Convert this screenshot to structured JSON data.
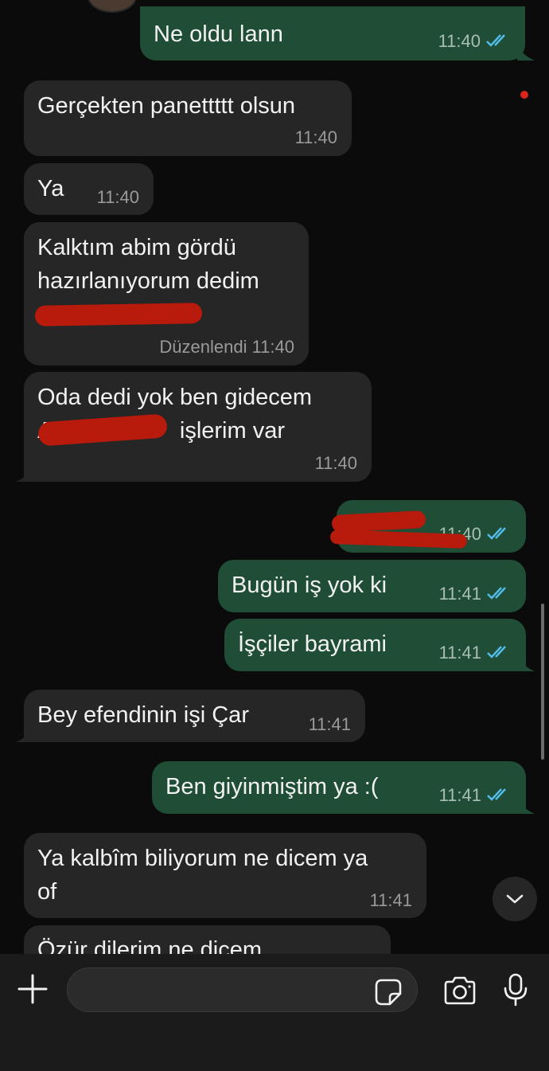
{
  "messages": [
    {
      "direction": "out",
      "text": "Ne oldu lann",
      "time": "11:40"
    },
    {
      "direction": "in",
      "text": "Gerçekten panettttt olsun",
      "time": "11:40"
    },
    {
      "direction": "in",
      "text": "Ya",
      "time": "11:40"
    },
    {
      "direction": "in",
      "text": "Kalktım abim gördü\nhazırlanıyorum dedim",
      "time": "11:40",
      "edited_label": "Düzenlendi"
    },
    {
      "direction": "in",
      "text": "Oda dedi yok ben gidecem\nA                    işlerim var",
      "time": "11:40"
    },
    {
      "direction": "out",
      "text": "",
      "time": "11:40"
    },
    {
      "direction": "out",
      "text": "Bugün iş yok ki",
      "time": "11:41"
    },
    {
      "direction": "out",
      "text": "İşçiler bayrami",
      "time": "11:41"
    },
    {
      "direction": "in",
      "text": "Bey efendinin işi Çar",
      "time": "11:41"
    },
    {
      "direction": "out",
      "text": "Ben giyinmiştim ya :(",
      "time": "11:41"
    },
    {
      "direction": "in",
      "text": "Ya kalbîm biliyorum ne dicem ya\nof",
      "time": "11:41"
    },
    {
      "direction": "in",
      "text": "Özür dilerim ne dicem",
      "time": ""
    }
  ],
  "composer": {
    "placeholder": ""
  },
  "icons": {
    "add": "plus-icon",
    "sticker": "sticker-icon",
    "camera": "camera-icon",
    "mic": "microphone-icon",
    "read_receipt": "double-check-icon",
    "scroll_down": "chevron-down-icon"
  },
  "colors": {
    "incoming": "#262626",
    "outgoing": "#1f4d36",
    "read_ticks": "#53bdeb",
    "background": "#0b0b0b"
  }
}
